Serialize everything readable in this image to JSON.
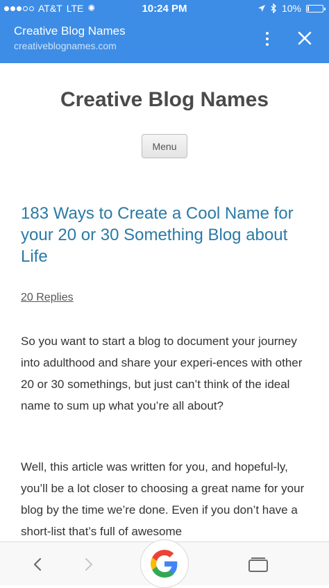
{
  "status_bar": {
    "carrier": "AT&T",
    "network": "LTE",
    "time": "10:24 PM",
    "battery_percent": "10%",
    "battery_level": 0.1,
    "signal_bars_filled": 3,
    "signal_bars_total": 5
  },
  "browser": {
    "tab_title": "Creative Blog Names",
    "tab_url": "creativeblognames.com",
    "accent_color": "#3d8de6"
  },
  "page": {
    "site_title": "Creative Blog Names",
    "menu_label": "Menu",
    "post_title": "183 Ways to Create a Cool Name for your 20 or 30 Something Blog about Life",
    "replies_link": "20 Replies",
    "paragraph_1": "So you want to start a blog to document your journey into adulthood and share your experi-ences with other 20 or 30 somethings, but just can’t think of the ideal name to sum up what you’re all about?",
    "paragraph_2": "Well, this article was written for you, and hopeful-ly, you’ll be a lot closer to choosing a great name for your blog by the time we’re done. Even if you don’t have a short-list that’s full of awesome"
  },
  "bottom_bar": {
    "icons": [
      "back-arrow-icon",
      "forward-arrow-icon",
      "google-g-icon",
      "tabs-icon"
    ]
  }
}
